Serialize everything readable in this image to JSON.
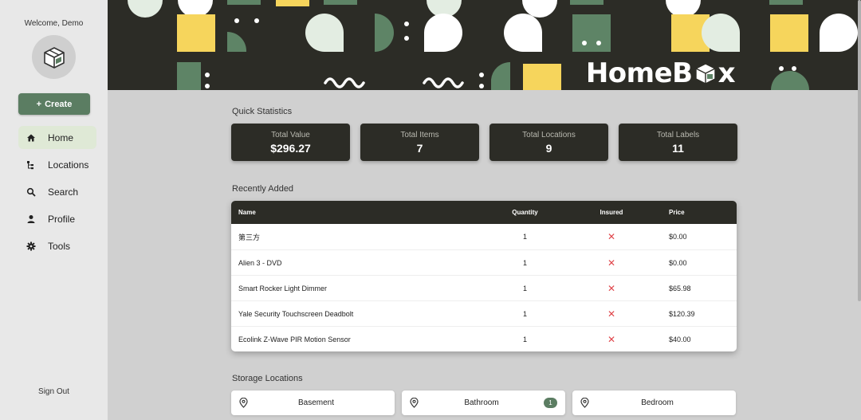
{
  "sidebar": {
    "welcome": "Welcome, Demo",
    "create_label": "Create",
    "nav": [
      {
        "label": "Home",
        "icon": "home-icon",
        "active": true
      },
      {
        "label": "Locations",
        "icon": "locations-icon",
        "active": false
      },
      {
        "label": "Search",
        "icon": "search-icon",
        "active": false
      },
      {
        "label": "Profile",
        "icon": "profile-icon",
        "active": false
      },
      {
        "label": "Tools",
        "icon": "gear-icon",
        "active": false
      }
    ],
    "signout": "Sign Out"
  },
  "banner": {
    "brand": "HomeB",
    "brand_suffix": "x"
  },
  "quick_stats": {
    "title": "Quick Statistics",
    "items": [
      {
        "label": "Total Value",
        "value": "$296.27"
      },
      {
        "label": "Total Items",
        "value": "7"
      },
      {
        "label": "Total Locations",
        "value": "9"
      },
      {
        "label": "Total Labels",
        "value": "11"
      }
    ]
  },
  "recent": {
    "title": "Recently Added",
    "headers": {
      "name": "Name",
      "quantity": "Quantity",
      "insured": "Insured",
      "price": "Price"
    },
    "rows": [
      {
        "name": "第三方",
        "quantity": "1",
        "insured": "✕",
        "price": "$0.00"
      },
      {
        "name": "Alien 3 - DVD",
        "quantity": "1",
        "insured": "✕",
        "price": "$0.00"
      },
      {
        "name": "Smart Rocker Light Dimmer",
        "quantity": "1",
        "insured": "✕",
        "price": "$65.98"
      },
      {
        "name": "Yale Security Touchscreen Deadbolt",
        "quantity": "1",
        "insured": "✕",
        "price": "$120.39"
      },
      {
        "name": "Ecolink Z-Wave PIR Motion Sensor",
        "quantity": "1",
        "insured": "✕",
        "price": "$40.00"
      }
    ]
  },
  "storage": {
    "title": "Storage Locations",
    "items": [
      {
        "name": "Basement",
        "count": ""
      },
      {
        "name": "Bathroom",
        "count": "1"
      },
      {
        "name": "Bedroom",
        "count": ""
      }
    ]
  },
  "colors": {
    "dark": "#2c2c26",
    "accent_green": "#5b7d62",
    "banner_yellow": "#f6d55c",
    "banner_sage": "#5e8466",
    "banner_mint": "#e3ede2",
    "insured_no": "#e0464b"
  }
}
